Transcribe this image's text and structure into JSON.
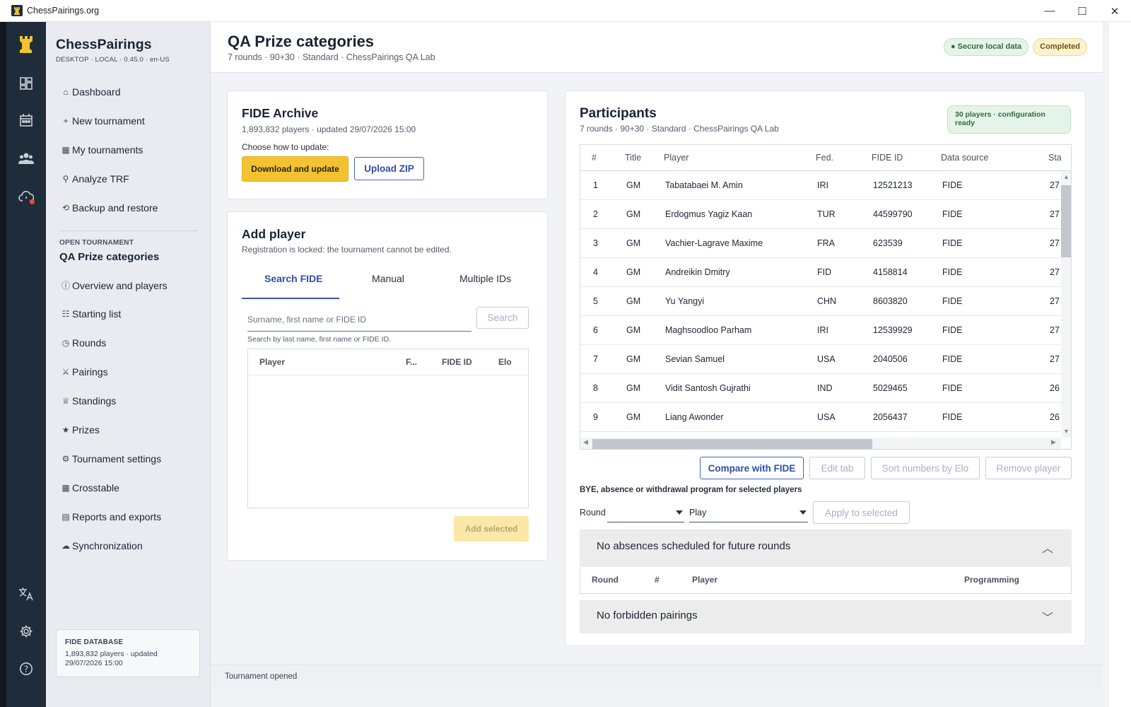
{
  "window": {
    "title": "ChessPairings.org"
  },
  "brand": {
    "name": "ChessPairings",
    "sub": "DESKTOP · LOCAL · 0.45.0 · en-US"
  },
  "nav": {
    "items": [
      {
        "label": "Dashboard",
        "glyph": "⌂"
      },
      {
        "label": "New tournament",
        "glyph": "+"
      },
      {
        "label": "My tournaments",
        "glyph": "▦"
      },
      {
        "label": "Analyze TRF",
        "glyph": "⚲"
      },
      {
        "label": "Backup and restore",
        "glyph": "⟲"
      }
    ],
    "open_label": "OPEN TOURNAMENT",
    "open_name": "QA Prize categories",
    "tournament_items": [
      {
        "label": "Overview and players",
        "glyph": "ⓘ"
      },
      {
        "label": "Starting list",
        "glyph": "☷"
      },
      {
        "label": "Rounds",
        "glyph": "◷"
      },
      {
        "label": "Pairings",
        "glyph": "⚔"
      },
      {
        "label": "Standings",
        "glyph": "♕"
      },
      {
        "label": "Prizes",
        "glyph": "★"
      },
      {
        "label": "Tournament settings",
        "glyph": "⚙"
      },
      {
        "label": "Crosstable",
        "glyph": "▦"
      },
      {
        "label": "Reports and exports",
        "glyph": "▤"
      },
      {
        "label": "Synchronization",
        "glyph": "☁"
      }
    ]
  },
  "fide_box": {
    "title": "FIDE DATABASE",
    "detail": "1,893,832 players · updated 29/07/2026 15:00"
  },
  "header": {
    "title": "QA Prize categories",
    "subtitle": "7 rounds · 90+30 · Standard · ChessPairings QA Lab",
    "badge_secure": "● Secure local data",
    "badge_status": "Completed"
  },
  "archive": {
    "title": "FIDE Archive",
    "info": "1,893,832 players · updated 29/07/2026 15:00",
    "prompt": "Choose how to update:",
    "download_label": "Download and update",
    "upload_label": "Upload ZIP"
  },
  "add_player": {
    "title": "Add player",
    "locked": "Registration is locked: the tournament cannot be edited.",
    "tabs": [
      "Search FIDE",
      "Manual",
      "Multiple IDs"
    ],
    "search_placeholder": "Surname, first name or FIDE ID",
    "search_button": "Search",
    "hint": "Search by last name, first name or FIDE ID.",
    "columns": [
      "Player",
      "F...",
      "FIDE ID",
      "Elo"
    ],
    "add_selected": "Add selected"
  },
  "participants": {
    "title": "Participants",
    "subtitle": "7 rounds · 90+30 · Standard · ChessPairings QA Lab",
    "badge": "30 players · configuration ready",
    "columns": [
      "#",
      "Title",
      "Player",
      "Fed.",
      "FIDE ID",
      "Data source",
      "Sta"
    ],
    "rows": [
      {
        "n": "1",
        "title": "GM",
        "player": "Tabatabaei M. Amin",
        "fed": "IRI",
        "fide": "12521213",
        "src": "FIDE",
        "sta": "27"
      },
      {
        "n": "2",
        "title": "GM",
        "player": "Erdogmus Yagiz Kaan",
        "fed": "TUR",
        "fide": "44599790",
        "src": "FIDE",
        "sta": "27"
      },
      {
        "n": "3",
        "title": "GM",
        "player": "Vachier-Lagrave Maxime",
        "fed": "FRA",
        "fide": "623539",
        "src": "FIDE",
        "sta": "27"
      },
      {
        "n": "4",
        "title": "GM",
        "player": "Andreikin Dmitry",
        "fed": "FID",
        "fide": "4158814",
        "src": "FIDE",
        "sta": "27"
      },
      {
        "n": "5",
        "title": "GM",
        "player": "Yu Yangyi",
        "fed": "CHN",
        "fide": "8603820",
        "src": "FIDE",
        "sta": "27"
      },
      {
        "n": "6",
        "title": "GM",
        "player": "Maghsoodloo Parham",
        "fed": "IRI",
        "fide": "12539929",
        "src": "FIDE",
        "sta": "27"
      },
      {
        "n": "7",
        "title": "GM",
        "player": "Sevian Samuel",
        "fed": "USA",
        "fide": "2040506",
        "src": "FIDE",
        "sta": "27"
      },
      {
        "n": "8",
        "title": "GM",
        "player": "Vidit Santosh Gujrathi",
        "fed": "IND",
        "fide": "5029465",
        "src": "FIDE",
        "sta": "26"
      },
      {
        "n": "9",
        "title": "GM",
        "player": "Liang Awonder",
        "fed": "USA",
        "fide": "2056437",
        "src": "FIDE",
        "sta": "26"
      }
    ],
    "compare_label": "Compare with FIDE",
    "edit_tab_label": "Edit tab",
    "sort_label": "Sort numbers by Elo",
    "remove_label": "Remove player",
    "bye_title": "BYE, absence or withdrawal program for selected players",
    "round_label": "Round",
    "round_value": "",
    "mode_value": "Play",
    "apply_label": "Apply to selected",
    "absences_label": "No absences scheduled for future rounds",
    "abs_columns": [
      "Round",
      "#",
      "Player",
      "Programming"
    ],
    "forbidden_label": "No forbidden pairings"
  },
  "status": {
    "text": "Tournament opened"
  },
  "colors": {
    "rail": "#1f2c3a",
    "accent": "#f2c230",
    "link": "#2f4ea8"
  }
}
